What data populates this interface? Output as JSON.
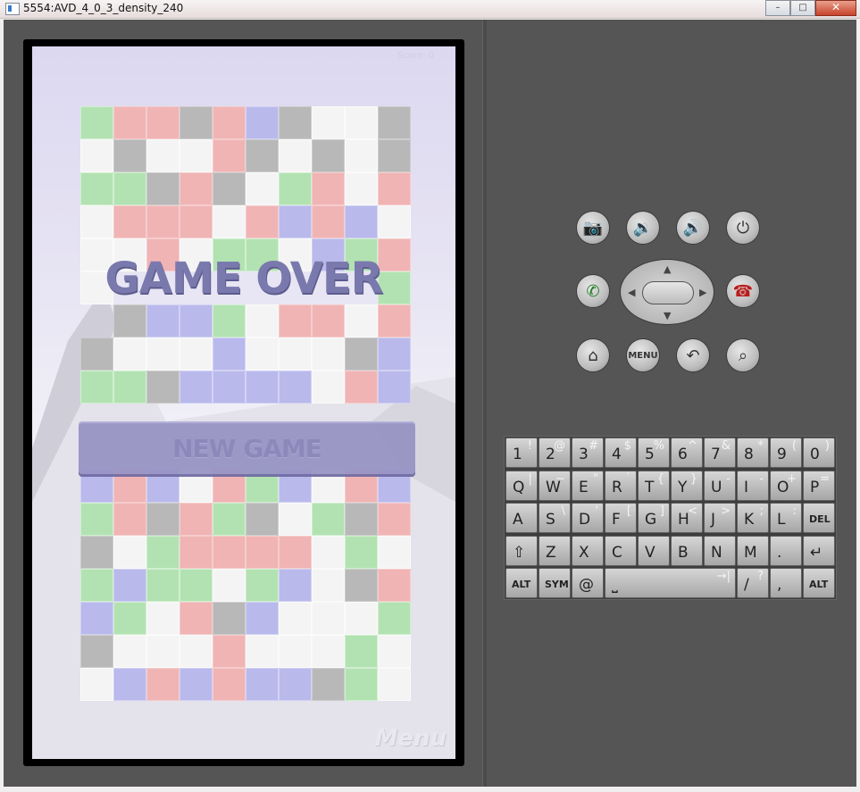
{
  "window": {
    "title": "5554:AVD_4_0_3_density_240",
    "minimize": "–",
    "maximize": "□",
    "close": "✕"
  },
  "game": {
    "score_label": "Score: 0",
    "game_over": "GAME OVER",
    "new_game": "NEW GAME",
    "menu_logo": "Menu",
    "grid_rows": [
      [
        "g",
        "r",
        "r",
        "k",
        "r",
        "b",
        "k",
        "w",
        "w",
        "k"
      ],
      [
        "w",
        "k",
        "w",
        "w",
        "r",
        "k",
        "w",
        "k",
        "w",
        "k"
      ],
      [
        "g",
        "g",
        "k",
        "r",
        "k",
        "w",
        "g",
        "r",
        "w",
        "r"
      ],
      [
        "w",
        "r",
        "r",
        "r",
        "w",
        "r",
        "b",
        "r",
        "b",
        "w"
      ],
      [
        "w",
        "w",
        "r",
        "w",
        "g",
        "g",
        "w",
        "b",
        "g",
        "r"
      ],
      [
        "w",
        "e",
        "e",
        "e",
        "e",
        "e",
        "e",
        "e",
        "e",
        "g"
      ],
      [
        "e",
        "k",
        "b",
        "b",
        "g",
        "w",
        "r",
        "r",
        "w",
        "r"
      ],
      [
        "k",
        "w",
        "w",
        "w",
        "b",
        "w",
        "w",
        "w",
        "k",
        "b"
      ],
      [
        "g",
        "g",
        "k",
        "b",
        "b",
        "b",
        "b",
        "w",
        "r",
        "b"
      ],
      [
        "e",
        "e",
        "e",
        "e",
        "e",
        "e",
        "e",
        "e",
        "e",
        "e"
      ],
      [
        "e",
        "e",
        "e",
        "e",
        "e",
        "e",
        "e",
        "e",
        "e",
        "e"
      ],
      [
        "b",
        "r",
        "b",
        "w",
        "r",
        "g",
        "b",
        "w",
        "r",
        "b"
      ],
      [
        "g",
        "r",
        "k",
        "r",
        "g",
        "k",
        "w",
        "g",
        "k",
        "r"
      ],
      [
        "k",
        "w",
        "g",
        "r",
        "r",
        "r",
        "r",
        "w",
        "g",
        "w"
      ],
      [
        "g",
        "b",
        "g",
        "g",
        "w",
        "g",
        "b",
        "w",
        "k",
        "r"
      ],
      [
        "b",
        "g",
        "w",
        "r",
        "k",
        "b",
        "w",
        "w",
        "w",
        "g"
      ],
      [
        "k",
        "w",
        "w",
        "w",
        "r",
        "w",
        "w",
        "w",
        "g",
        "w"
      ],
      [
        "w",
        "b",
        "r",
        "b",
        "r",
        "b",
        "b",
        "k",
        "g",
        "w"
      ]
    ]
  },
  "controls": {
    "camera_icon": "📷",
    "vol_down_icon": "🔉",
    "vol_up_icon": "🔊",
    "power_icon": "⏻",
    "call_icon": "✆",
    "endcall_icon": "☎",
    "home_icon": "⌂",
    "menu_label": "MENU",
    "back_icon": "↶",
    "search_icon": "⌕",
    "dpad_up": "▲",
    "dpad_down": "▼",
    "dpad_left": "◀",
    "dpad_right": "▶"
  },
  "keyboard": {
    "row1": [
      [
        "1",
        "!"
      ],
      [
        "2",
        "@"
      ],
      [
        "3",
        "#"
      ],
      [
        "4",
        "$"
      ],
      [
        "5",
        "%"
      ],
      [
        "6",
        "^"
      ],
      [
        "7",
        "&"
      ],
      [
        "8",
        "*"
      ],
      [
        "9",
        "("
      ],
      [
        "0",
        ")"
      ]
    ],
    "row2": [
      [
        "Q",
        "|"
      ],
      [
        "W",
        "~"
      ],
      [
        "E",
        "\""
      ],
      [
        "R",
        "`"
      ],
      [
        "T",
        "{"
      ],
      [
        "Y",
        "}"
      ],
      [
        "U",
        "-"
      ],
      [
        "I",
        "-"
      ],
      [
        "O",
        "+"
      ],
      [
        "P",
        "="
      ]
    ],
    "row3": [
      [
        "A",
        ""
      ],
      [
        "S",
        "\\"
      ],
      [
        "D",
        "'"
      ],
      [
        "F",
        "["
      ],
      [
        "G",
        "]"
      ],
      [
        "H",
        "<"
      ],
      [
        "J",
        ">"
      ],
      [
        "K",
        ";"
      ],
      [
        "L",
        ":"
      ],
      [
        "DEL",
        ""
      ]
    ],
    "row4": [
      [
        "⇧",
        ""
      ],
      [
        "Z",
        ""
      ],
      [
        "X",
        ""
      ],
      [
        "C",
        ""
      ],
      [
        "V",
        ""
      ],
      [
        "B",
        ""
      ],
      [
        "N",
        ""
      ],
      [
        "M",
        ""
      ],
      [
        ".",
        ""
      ],
      [
        "↵",
        ""
      ]
    ],
    "row5": {
      "alt_left": "ALT",
      "sym": "SYM",
      "at": "@",
      "space": "⎵",
      "tab": "→|",
      "slash": "/",
      "question": "?",
      "comma": ",",
      "alt_right": "ALT"
    }
  }
}
